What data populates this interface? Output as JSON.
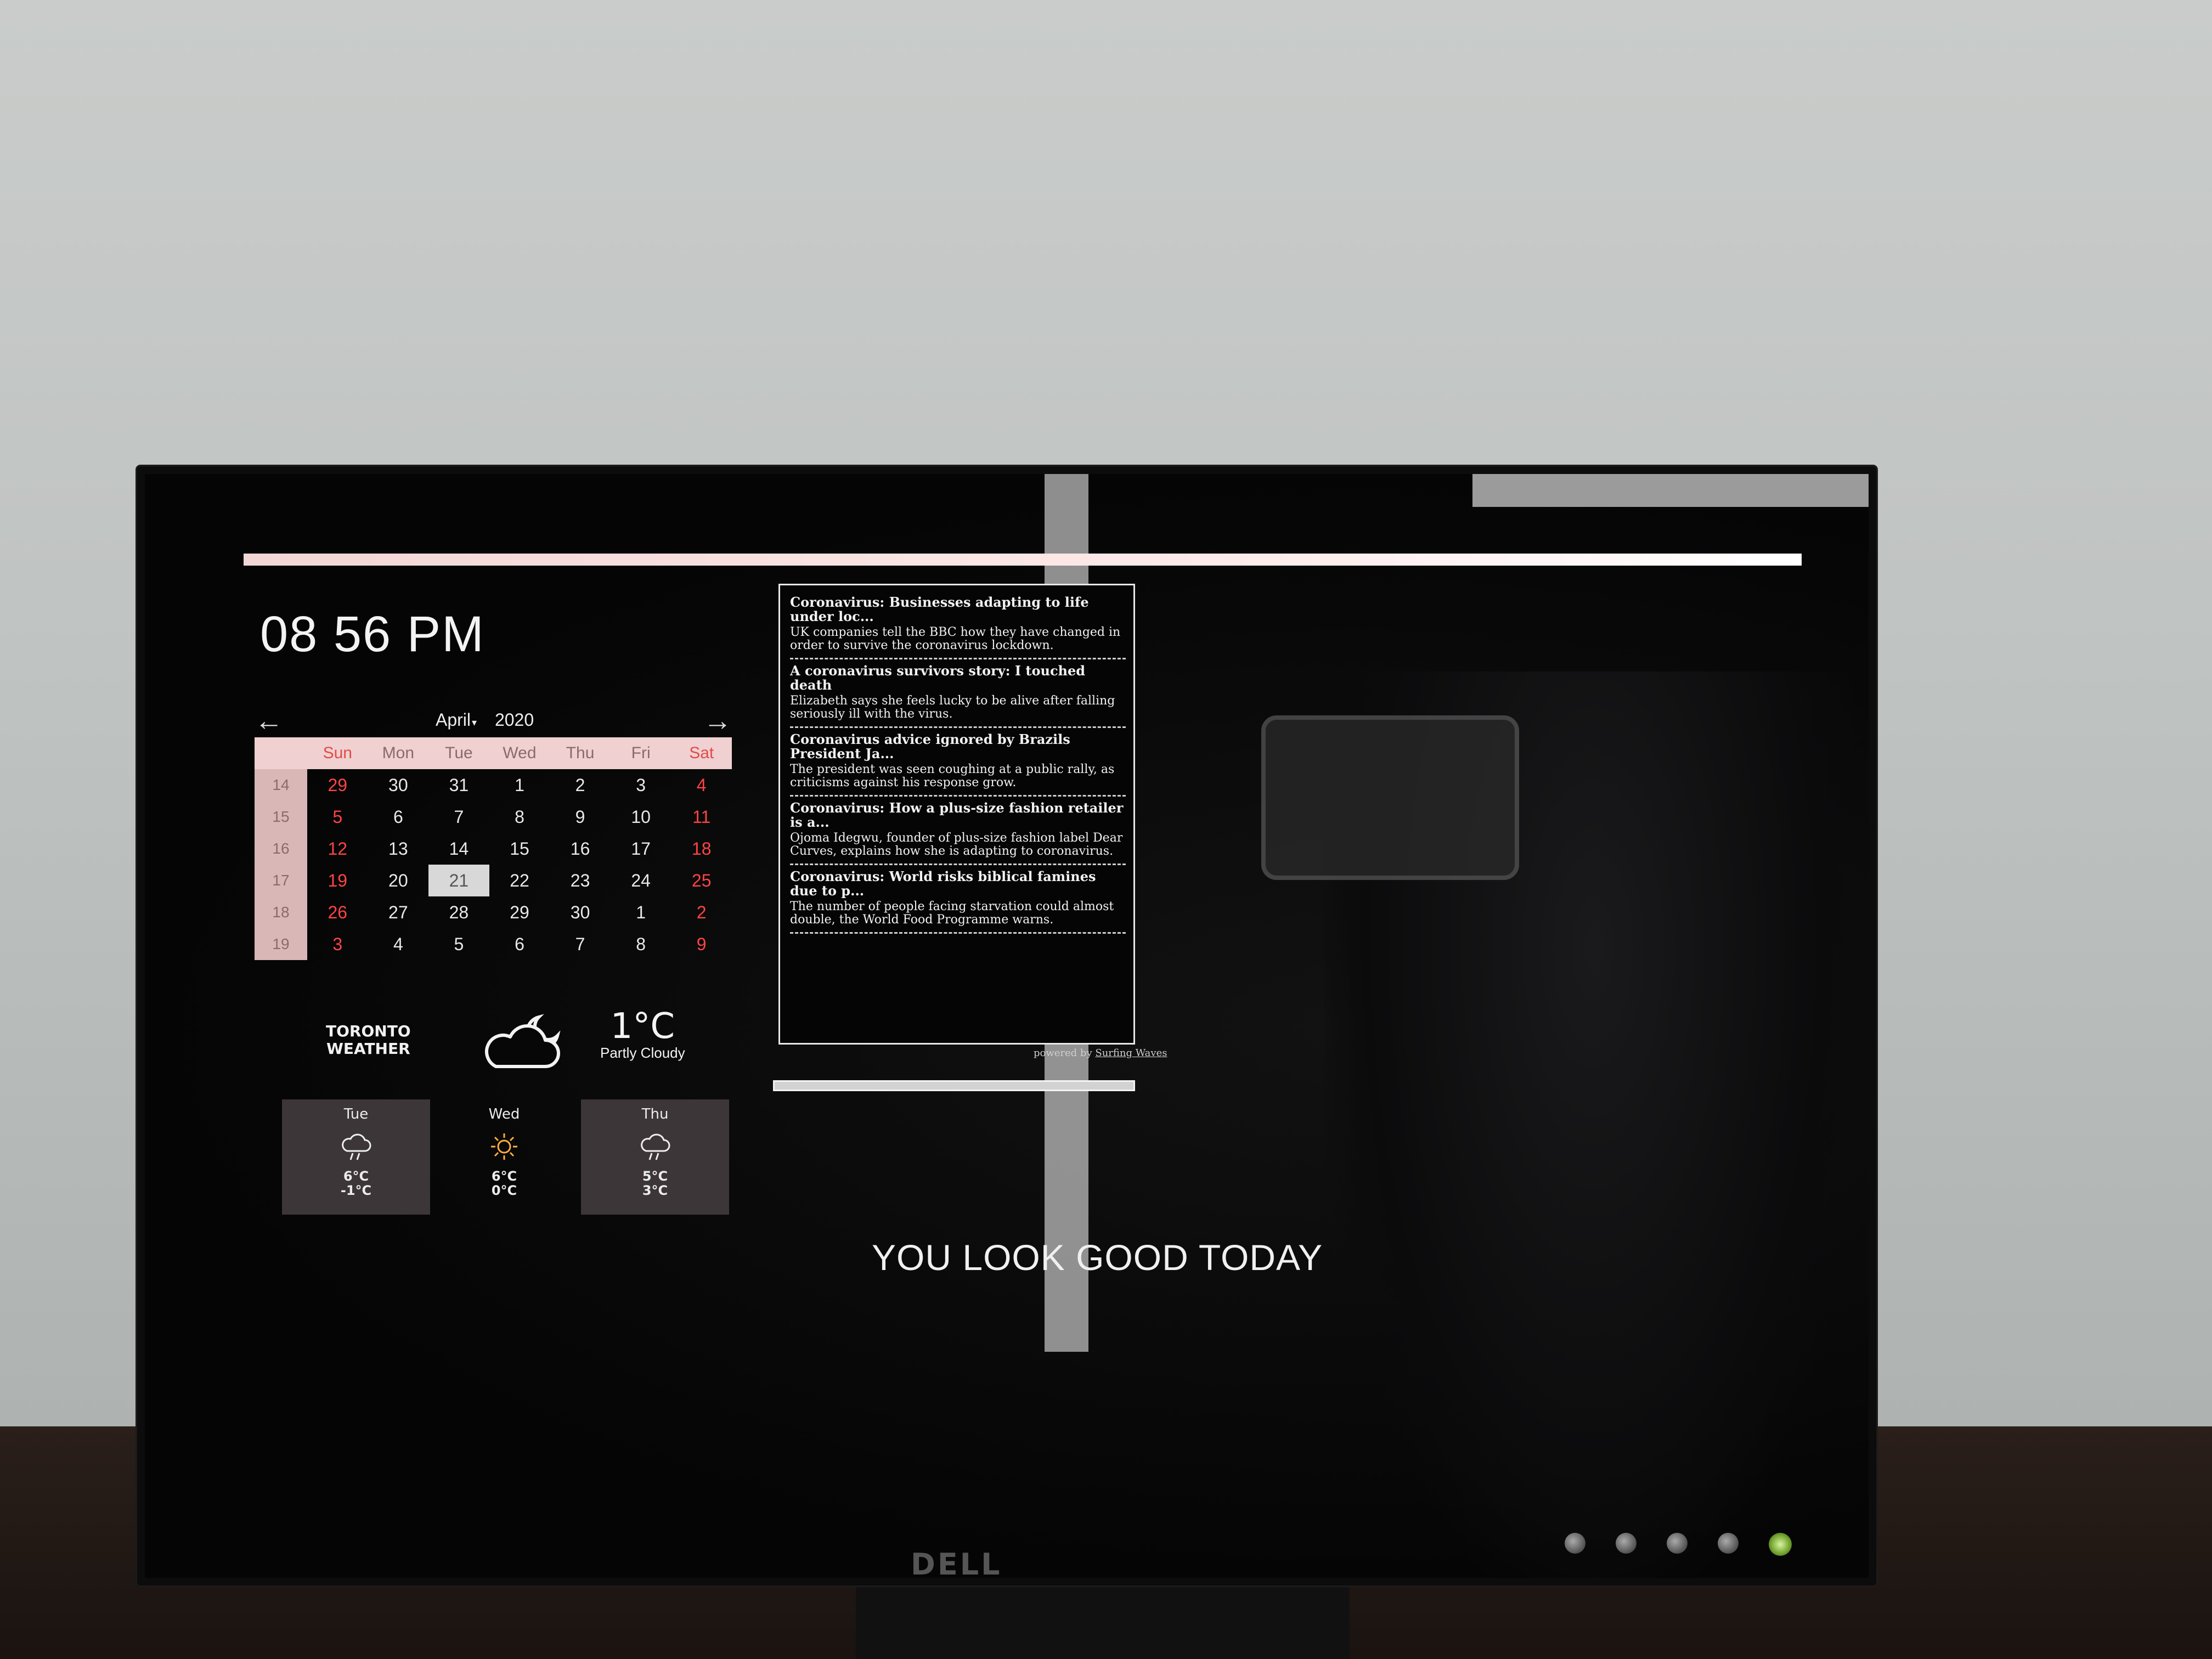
{
  "clock": {
    "time": "08 56 PM"
  },
  "calendar": {
    "prev_icon": "arrow-left-icon",
    "next_icon": "arrow-right-icon",
    "month": "April",
    "year": "2020",
    "headers": [
      "Sun",
      "Mon",
      "Tue",
      "Wed",
      "Thu",
      "Fri",
      "Sat"
    ],
    "weeks": [
      {
        "num": "14",
        "days": [
          "29",
          "30",
          "31",
          "1",
          "2",
          "3",
          "4"
        ]
      },
      {
        "num": "15",
        "days": [
          "5",
          "6",
          "7",
          "8",
          "9",
          "10",
          "11"
        ]
      },
      {
        "num": "16",
        "days": [
          "12",
          "13",
          "14",
          "15",
          "16",
          "17",
          "18"
        ]
      },
      {
        "num": "17",
        "days": [
          "19",
          "20",
          "21",
          "22",
          "23",
          "24",
          "25"
        ]
      },
      {
        "num": "18",
        "days": [
          "26",
          "27",
          "28",
          "29",
          "30",
          "1",
          "2"
        ]
      },
      {
        "num": "19",
        "days": [
          "3",
          "4",
          "5",
          "6",
          "7",
          "8",
          "9"
        ]
      }
    ],
    "today": "21"
  },
  "weather": {
    "city_line1": "TORONTO",
    "city_line2": "WEATHER",
    "current_icon": "partly-cloudy-night-icon",
    "temperature": "1°C",
    "condition": "Partly Cloudy",
    "forecast": [
      {
        "day": "Tue",
        "icon": "rain-cloud-icon",
        "high": "6°C",
        "low": "-1°C"
      },
      {
        "day": "Wed",
        "icon": "sun-icon",
        "high": "6°C",
        "low": "0°C"
      },
      {
        "day": "Thu",
        "icon": "rain-cloud-icon",
        "high": "5°C",
        "low": "3°C"
      }
    ]
  },
  "news": {
    "items": [
      {
        "title": "Coronavirus: Businesses adapting to life under loc...",
        "desc": "UK companies tell the BBC how they have changed in order to survive the coronavirus lockdown."
      },
      {
        "title": "A coronavirus survivors story: I touched death",
        "desc": "Elizabeth says she feels lucky to be alive after falling seriously ill with the virus."
      },
      {
        "title": "Coronavirus advice ignored by Brazils President Ja...",
        "desc": "The president was seen coughing at a public rally, as criticisms against his response grow."
      },
      {
        "title": "Coronavirus: How a plus-size fashion retailer is a...",
        "desc": "Ojoma Idegwu, founder of plus-size fashion label Dear Curves, explains how she is adapting to coronavirus."
      },
      {
        "title": "Coronavirus: World risks biblical famines due to p...",
        "desc": "The number of people facing starvation could almost double, the World Food Programme warns."
      }
    ],
    "credit_prefix": "powered by",
    "credit_link": "Surfing Waves"
  },
  "compliment": "YOU LOOK GOOD TODAY",
  "hardware": {
    "stand_logo": "DELL"
  },
  "colors": {
    "weekend_red": "#ff4444",
    "header_pink": "#f0d0d0",
    "power_led": "#8ec63f"
  }
}
